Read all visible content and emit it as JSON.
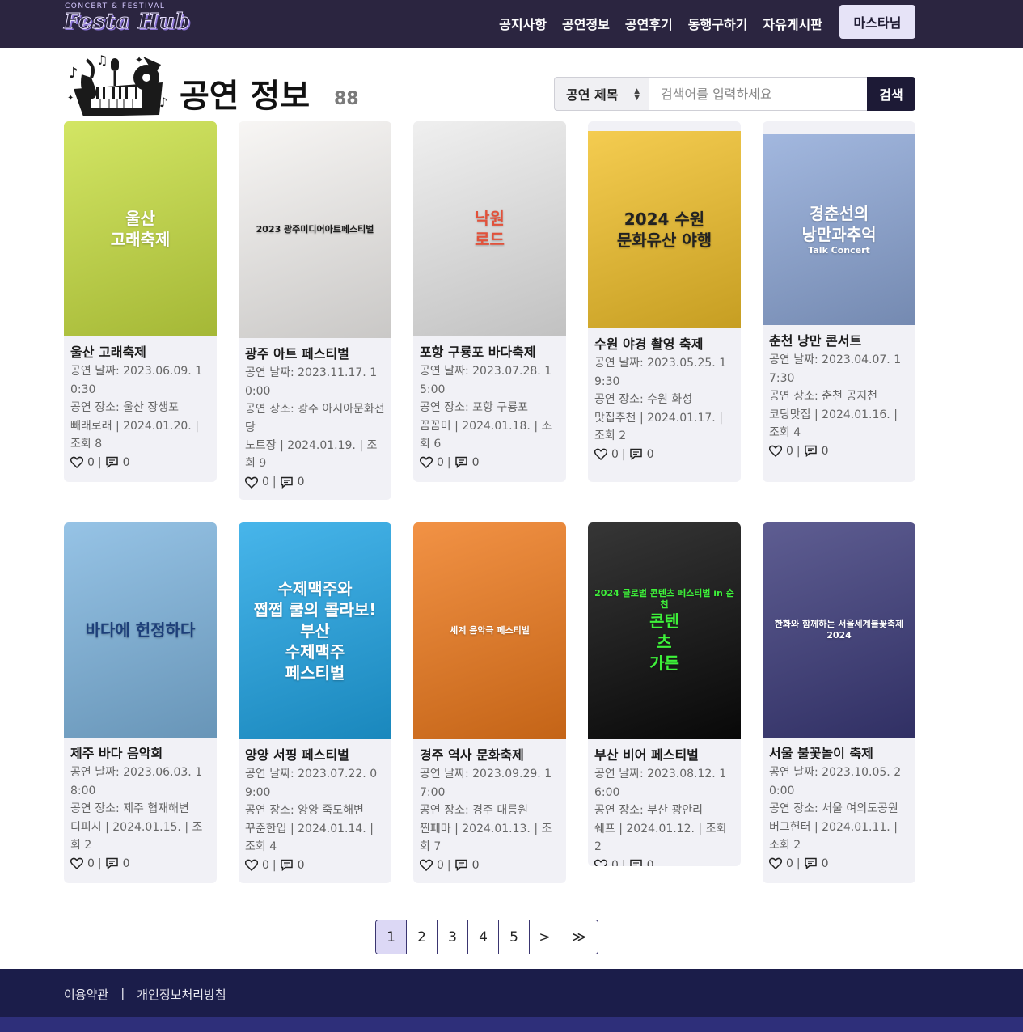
{
  "nav": {
    "logo_small": "CONCERT & FESTIVAL",
    "logo_main": "Festa Hub",
    "links": [
      "공지사항",
      "공연정보",
      "공연후기",
      "동행구하기",
      "자유게시판"
    ],
    "user_button": "마스타님"
  },
  "header": {
    "title": "공연 정보",
    "count": "88"
  },
  "search": {
    "select_value": "공연 제목",
    "placeholder": "검색어를 입력하세요",
    "button": "검색"
  },
  "cards": [
    {
      "title": "울산 고래축제",
      "date": "공연 날짜: 2023.06.09. 10:30",
      "place": "공연 장소: 울산 장생포",
      "meta": "빼래로래 | 2024.01.20. | 조회 8",
      "likes": "0",
      "comments": "0",
      "poster_lines": [
        "울산",
        "고래축제"
      ],
      "poster_bg": "#c9e042",
      "poster_fg": "#ffffff"
    },
    {
      "title": "광주 아트 페스티벌",
      "date": "공연 날짜: 2023.11.17. 10:00",
      "place": "공연 장소: 광주 아시아문화전당",
      "meta": "노트장 | 2024.01.19. | 조회 9",
      "likes": "0",
      "comments": "0",
      "poster_lines": [
        "2023 광주미디어아트페스티벌"
      ],
      "poster_bg": "#f6f4f2",
      "poster_fg": "#1a1a1a"
    },
    {
      "title": "포항 구룡포 바다축제",
      "date": "공연 날짜: 2023.07.28. 15:00",
      "place": "공연 장소: 포항 구룡포",
      "meta": "꼼꼼미 | 2024.01.18. | 조회 6",
      "likes": "0",
      "comments": "0",
      "poster_lines": [
        "낙원",
        "로드"
      ],
      "poster_bg": "#ececec",
      "poster_fg": "#e2513a"
    },
    {
      "title": "수원 야경 촬영 축제",
      "date": "공연 날짜: 2023.05.25. 19:30",
      "place": "공연 장소: 수원 화성",
      "meta": "맛집추천 | 2024.01.17. | 조회 2",
      "likes": "0",
      "comments": "0",
      "poster_lines": [
        "2024 수원",
        "문화유산 야행"
      ],
      "poster_bg": "#f2c12a",
      "poster_fg": "#222222"
    },
    {
      "title": "춘천 낭만 콘서트",
      "date": "공연 날짜: 2023.04.07. 17:30",
      "place": "공연 장소: 춘천 공지천",
      "meta": "코딩맛집 | 2024.01.16. | 조회 4",
      "likes": "0",
      "comments": "0",
      "poster_lines": [
        "경춘선의",
        "낭만과추억",
        "Talk Concert"
      ],
      "poster_bg": "#8ea8d8",
      "poster_fg": "#ffffff"
    },
    {
      "title": "제주 바다 음악회",
      "date": "공연 날짜: 2023.06.03. 18:00",
      "place": "공연 장소: 제주 협재해변",
      "meta": "디피시 | 2024.01.15. | 조회 2",
      "likes": "0",
      "comments": "0",
      "poster_lines": [
        "바다에 헌정하다"
      ],
      "poster_bg": "#7fb6e0",
      "poster_fg": "#1d3f7a"
    },
    {
      "title": "양양 서핑 페스티벌",
      "date": "공연 날짜: 2023.07.22. 09:00",
      "place": "공연 장소: 양양 죽도해변",
      "meta": "꾸준한입 | 2024.01.14. | 조회 4",
      "likes": "0",
      "comments": "0",
      "poster_lines": [
        "수제맥주와",
        "쩝쩝 쿨의 콜라보!",
        "부산",
        "수제맥주",
        "페스티벌"
      ],
      "poster_bg": "#1fa5e6",
      "poster_fg": "#ffffff"
    },
    {
      "title": "경주 역사 문화축제",
      "date": "공연 날짜: 2023.09.29. 17:00",
      "place": "공연 장소: 경주 대릉원",
      "meta": "찐페마 | 2024.01.13. | 조회 7",
      "likes": "0",
      "comments": "0",
      "poster_lines": [
        "세계 음악극 페스티벌"
      ],
      "poster_bg": "#ef7a1c",
      "poster_fg": "#ffffff"
    },
    {
      "title": "부산 비어 페스티벌",
      "date": "공연 날짜: 2023.08.12. 16:00",
      "place": "공연 장소: 부산 광안리",
      "meta": "쉐프 | 2024.01.12. | 조회 2",
      "likes": "0",
      "comments": "0",
      "poster_lines": [
        "2024 글로벌 콘텐츠 페스티벌 in 순천",
        "콘텐",
        "츠",
        "가든"
      ],
      "poster_bg": "#0a0a0a",
      "poster_fg": "#3ef23a"
    },
    {
      "title": "서울 불꽃놀이 축제",
      "date": "공연 날짜: 2023.10.05. 20:00",
      "place": "공연 장소: 서울 여의도공원",
      "meta": "버그헌터 | 2024.01.11. | 조회 2",
      "likes": "0",
      "comments": "0",
      "poster_lines": [
        "한화와 함께하는 서울세계불꽃축제 2024"
      ],
      "poster_bg": "#3b3a7a",
      "poster_fg": "#ffffff"
    }
  ],
  "pagination": {
    "pages": [
      "1",
      "2",
      "3",
      "4",
      "5"
    ],
    "next": ">",
    "last": "≫",
    "active": "1"
  },
  "footer": {
    "terms": "이용약관",
    "separator": "|",
    "privacy": "개인정보처리방침"
  }
}
